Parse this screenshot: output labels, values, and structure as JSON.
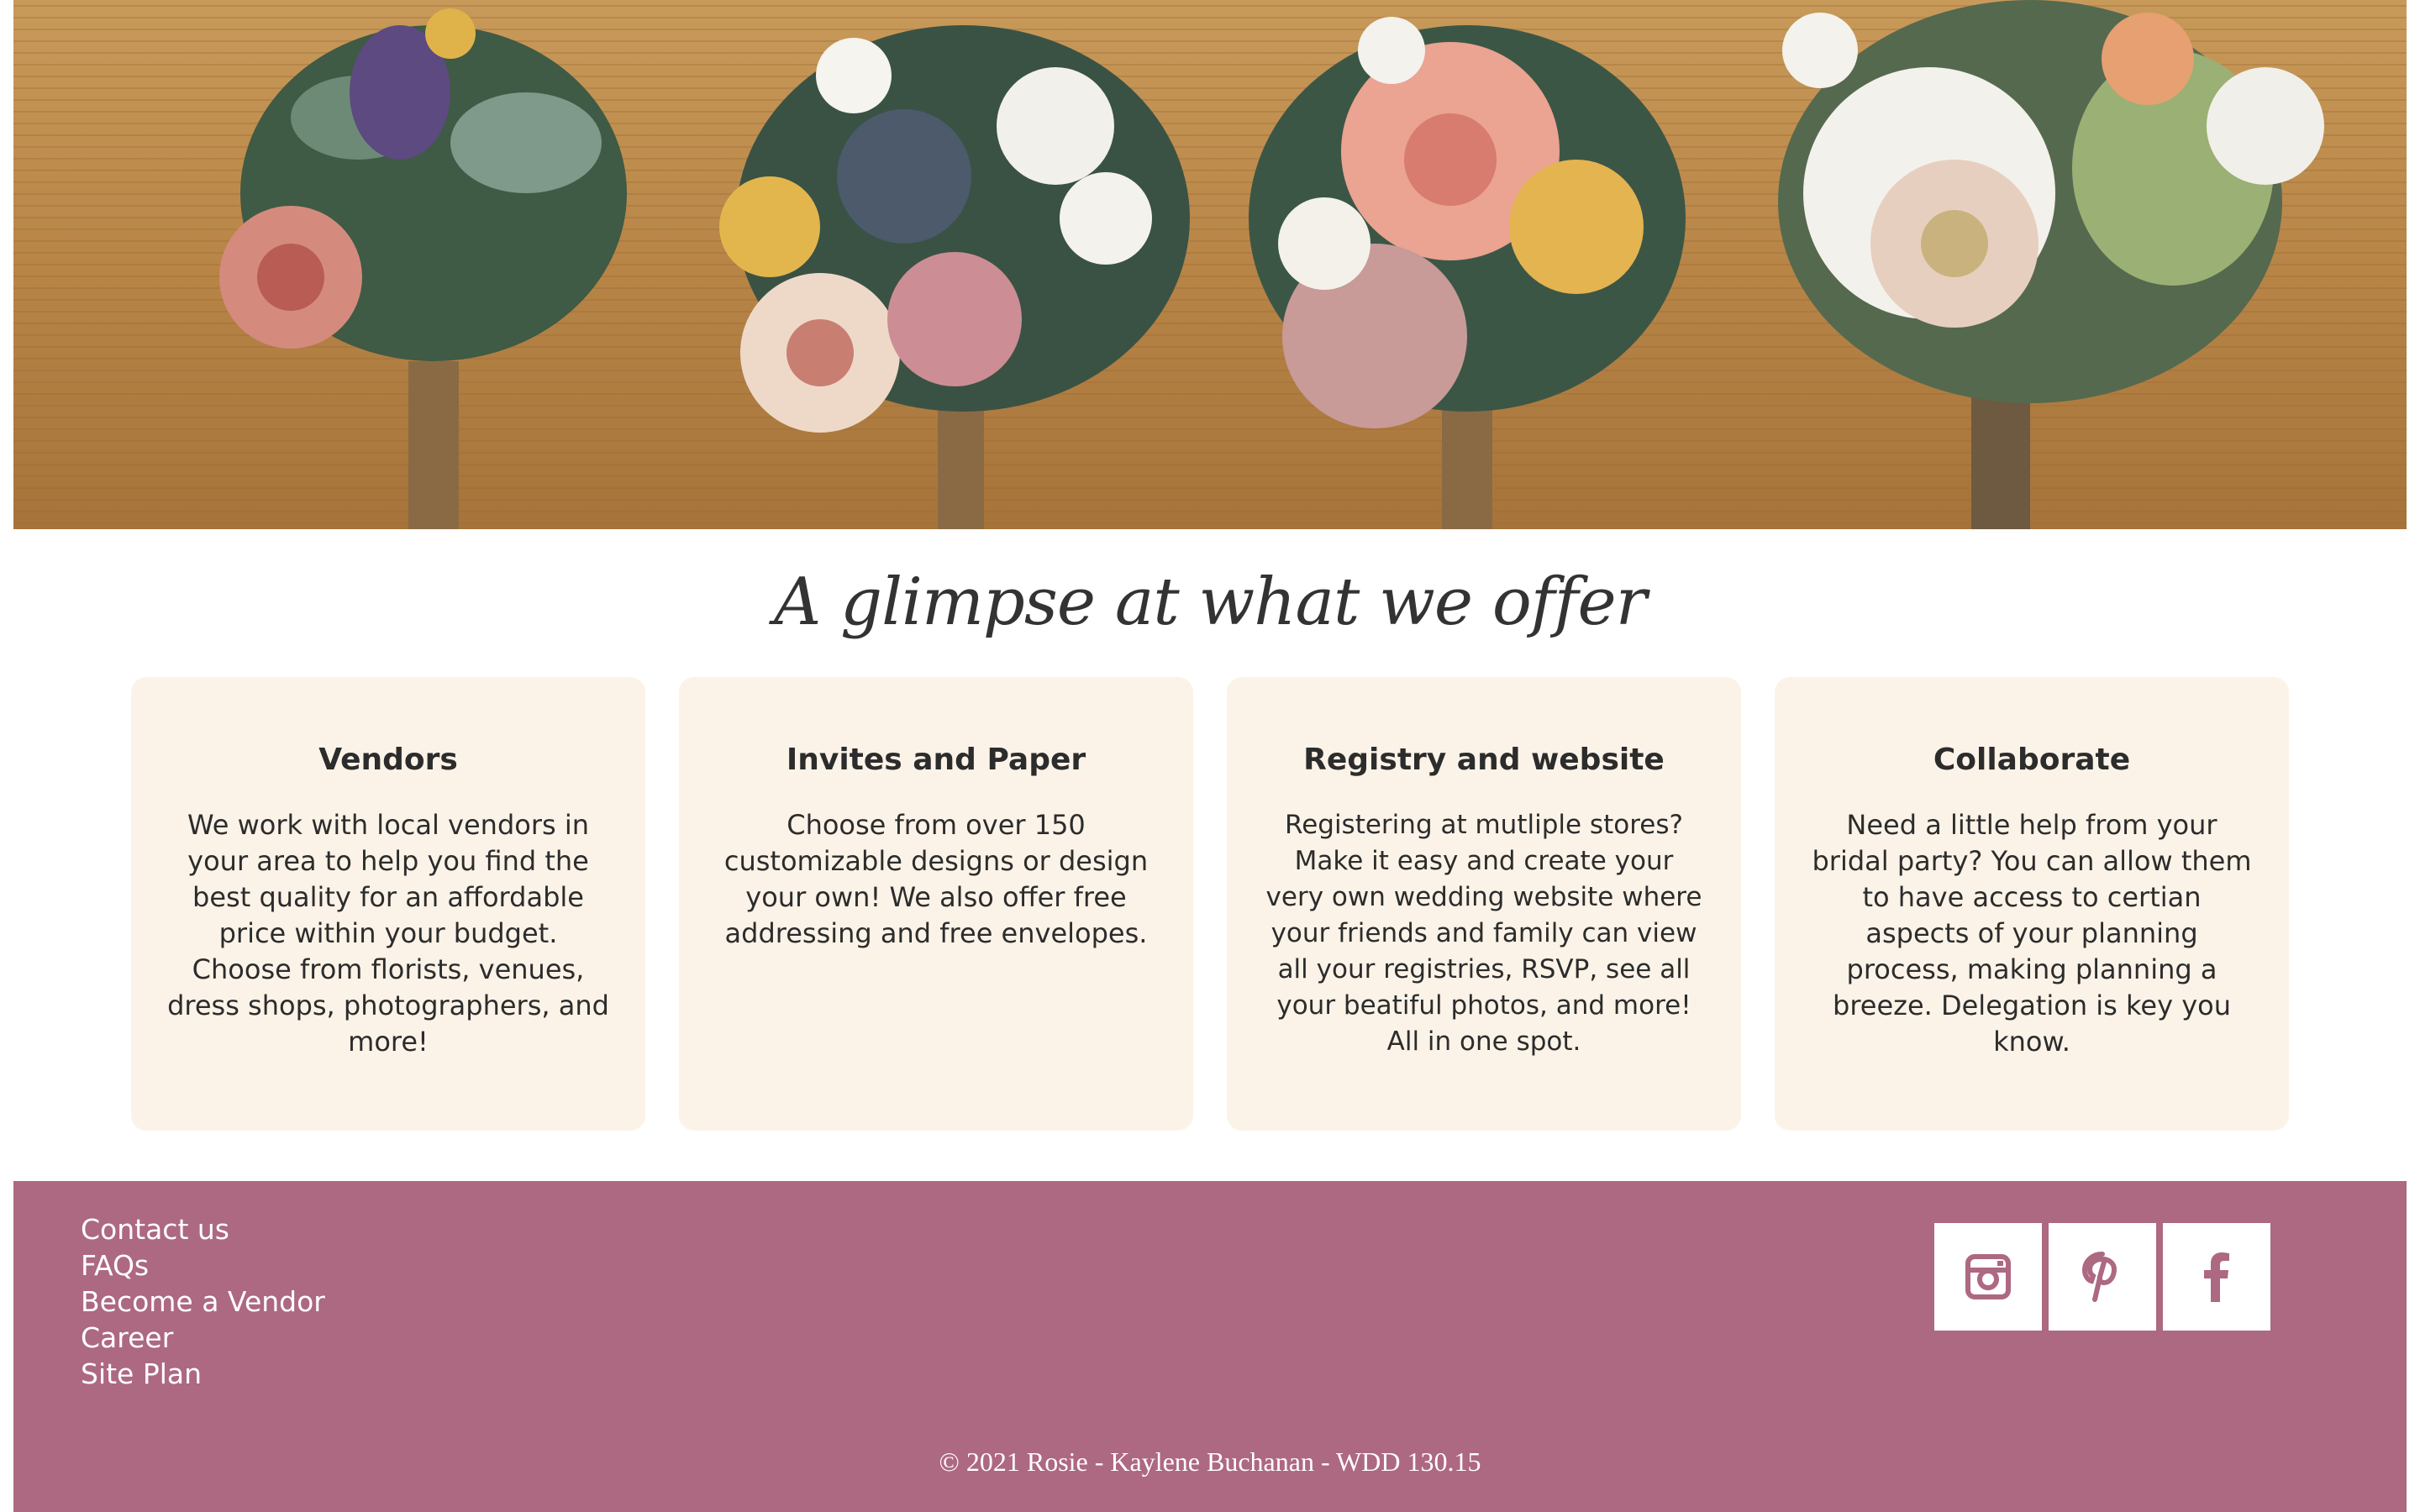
{
  "hero": {
    "image_alt": "Boutonnieres on wooden table"
  },
  "offer": {
    "title": "A glimpse at what we offer",
    "cards": [
      {
        "title": "Vendors",
        "text": "We work with local vendors in your area to help you find the best quality for an affordable price within your budget. Choose from florists, venues, dress shops, photographers, and more!"
      },
      {
        "title": "Invites and Paper",
        "text": "Choose from over 150 customizable designs or design your own! We also offer free addressing and free envelopes."
      },
      {
        "title": "Registry and website",
        "text": "Registering at mutliple stores? Make it easy and create your very own wedding website where your friends and family can view all your registries, RSVP, see all your beatiful photos, and more! All in one spot."
      },
      {
        "title": "Collaborate",
        "text": "Need a little help from your bridal party? You can allow them to have access to certian aspects of your planning process, making planning a breeze. Delegation is key you know."
      }
    ]
  },
  "footer": {
    "links": [
      "Contact us",
      "FAQs",
      "Become a Vendor",
      "Career",
      "Site Plan"
    ],
    "social": [
      {
        "icon": "instagram-icon"
      },
      {
        "icon": "pinterest-icon"
      },
      {
        "icon": "facebook-icon"
      }
    ],
    "copyright": "© 2021 Rosie - Kaylene Buchanan - WDD 130.15"
  },
  "colors": {
    "footer_bg": "#ad6882",
    "card_bg": "#fcf3e8",
    "icon_color": "#ad6882"
  }
}
